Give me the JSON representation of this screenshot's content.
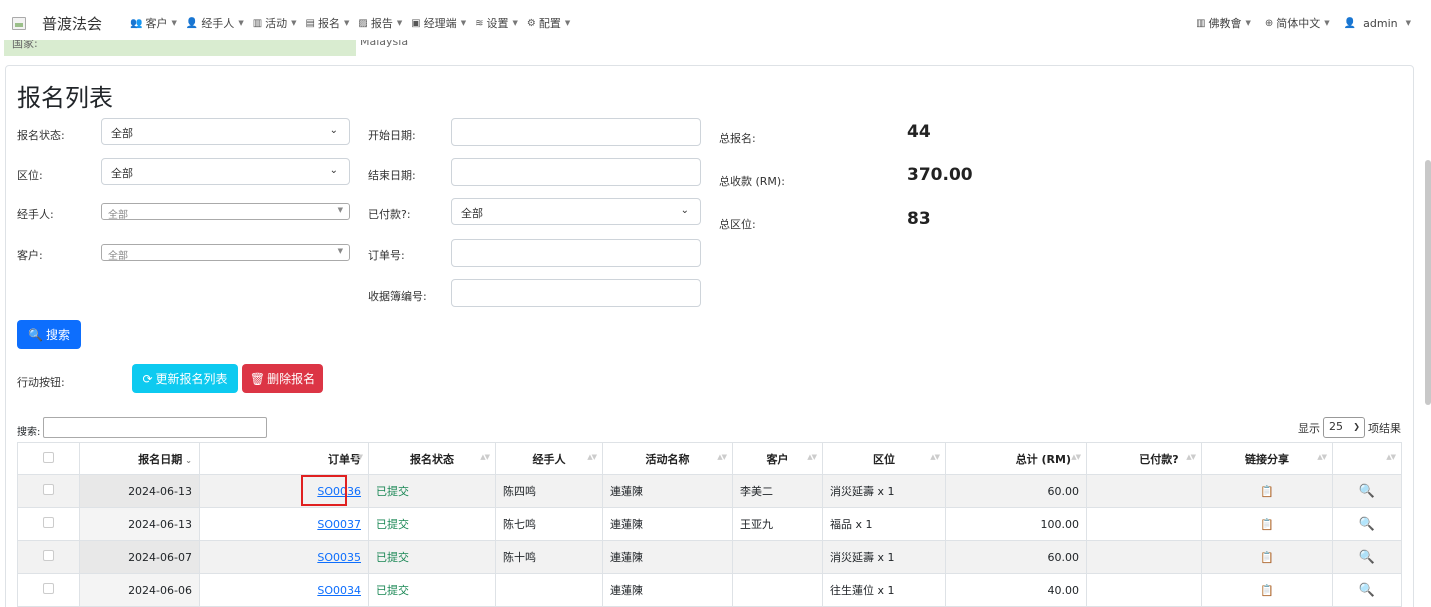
{
  "navbar": {
    "brand": "普渡法会",
    "items": [
      {
        "label": "客户",
        "icon": "users-icon",
        "glyph": "👥"
      },
      {
        "label": "经手人",
        "icon": "user-icon",
        "glyph": "👤"
      },
      {
        "label": "活动",
        "icon": "map-icon",
        "glyph": "▥"
      },
      {
        "label": "报名",
        "icon": "form-icon",
        "glyph": "▤"
      },
      {
        "label": "报告",
        "icon": "report-icon",
        "glyph": "▨"
      },
      {
        "label": "经理端",
        "icon": "briefcase-icon",
        "glyph": "▣"
      },
      {
        "label": "设置",
        "icon": "settings-icon",
        "glyph": "≋"
      },
      {
        "label": "配置",
        "icon": "gear-icon",
        "glyph": "⚙"
      }
    ],
    "org": "佛教會",
    "language": "简体中文",
    "user": "admin"
  },
  "peek": {
    "label": "国家:",
    "value": "Malaysia"
  },
  "page_title": "报名列表",
  "filters": {
    "status_label": "报名状态:",
    "status_value": "全部",
    "zone_label": "区位:",
    "zone_value": "全部",
    "handler_label": "经手人:",
    "handler_value": "全部",
    "customer_label": "客户:",
    "customer_value": "全部",
    "start_label": "开始日期:",
    "end_label": "结束日期:",
    "paid_label": "已付款?:",
    "paid_value": "全部",
    "order_label": "订单号:",
    "receipt_label": "收据簿编号:"
  },
  "stats": {
    "total_reg_label": "总报名:",
    "total_reg": "44",
    "total_income_label": "总收款 (RM):",
    "total_income": "370.00",
    "total_zone_label": "总区位:",
    "total_zone": "83"
  },
  "buttons": {
    "search": "搜索",
    "actions_label": "行动按钮:",
    "refresh": "更新报名列表",
    "delete": "删除报名"
  },
  "table": {
    "search_label": "搜索:",
    "show_label": "显示",
    "page_size": "25",
    "entries_label": "项结果",
    "headers": [
      "报名日期",
      "订单号",
      "报名状态",
      "经手人",
      "活动名称",
      "客户",
      "区位",
      "总计 (RM)",
      "已付款?",
      "链接分享"
    ],
    "rows": [
      {
        "date": "2024-06-13",
        "order": "SO0036",
        "status": "已提交",
        "handler": "陈四鸣",
        "event": "連蓮陳",
        "customer": "李美二",
        "zone": "消災延壽 x 1",
        "total": "60.00",
        "paid": ""
      },
      {
        "date": "2024-06-13",
        "order": "SO0037",
        "status": "已提交",
        "handler": "陈七鸣",
        "event": "連蓮陳",
        "customer": "王亚九",
        "zone": "福品 x 1",
        "total": "100.00",
        "paid": ""
      },
      {
        "date": "2024-06-07",
        "order": "SO0035",
        "status": "已提交",
        "handler": "陈十鸣",
        "event": "連蓮陳",
        "customer": "",
        "zone": "消災延壽 x 1",
        "total": "60.00",
        "paid": ""
      },
      {
        "date": "2024-06-06",
        "order": "SO0034",
        "status": "已提交",
        "handler": "",
        "event": "連蓮陳",
        "customer": "",
        "zone": "往生蓮位 x 1",
        "total": "40.00",
        "paid": ""
      }
    ]
  }
}
